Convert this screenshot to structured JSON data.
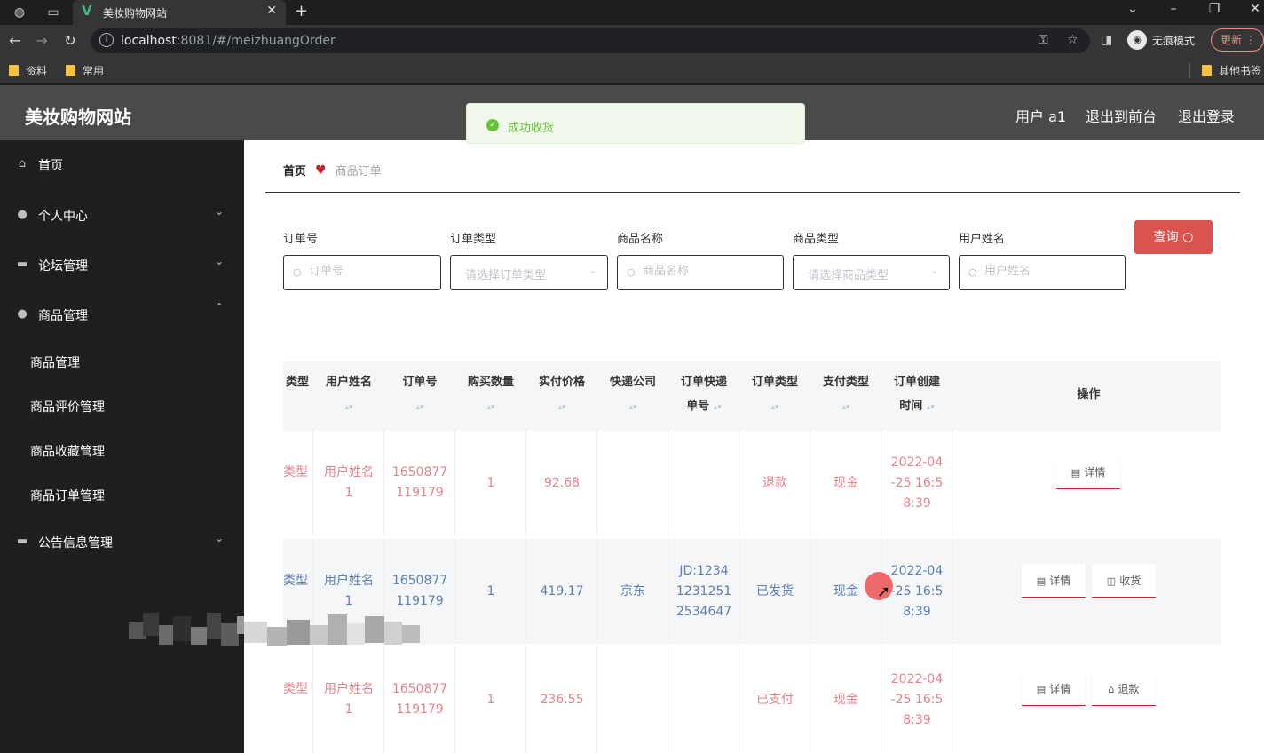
{
  "browser": {
    "tab_title": "美妆购物网站",
    "url_host": "localhost",
    "url_rest": ":8081/#/meizhuangOrder",
    "incognito_label": "无痕模式",
    "update_label": "更新",
    "bookmarks": [
      "资料",
      "常用"
    ],
    "other_bookmarks": "其他书签"
  },
  "header": {
    "site_title": "美妆购物网站",
    "user": "用户 a1",
    "front_link": "退出到前台",
    "logout_link": "退出登录"
  },
  "toast": {
    "text": "成功收货"
  },
  "sidebar": {
    "home": "首页",
    "personal": "个人中心",
    "forum": "论坛管理",
    "goods": "商品管理",
    "sub": [
      "商品管理",
      "商品评价管理",
      "商品收藏管理",
      "商品订单管理"
    ],
    "notice": "公告信息管理"
  },
  "breadcrumb": {
    "home": "首页",
    "current": "商品订单"
  },
  "filters": {
    "order_no": {
      "label": "订单号",
      "placeholder": "订单号"
    },
    "order_type": {
      "label": "订单类型",
      "placeholder": "请选择订单类型"
    },
    "goods_name": {
      "label": "商品名称",
      "placeholder": "商品名称"
    },
    "goods_type": {
      "label": "商品类型",
      "placeholder": "请选择商品类型"
    },
    "user_name": {
      "label": "用户姓名",
      "placeholder": "用户姓名"
    },
    "query_button": "查询"
  },
  "table": {
    "headers": {
      "type_partial": "类型",
      "user": "用户姓名",
      "order_no": "订单号",
      "qty": "购买数量",
      "price": "实付价格",
      "courier": "快递公司",
      "tracking_1": "订单快递",
      "tracking_2": "单号",
      "order_type": "订单类型",
      "pay_type": "支付类型",
      "created_1": "订单创建",
      "created_2": "时间",
      "ops": "操作"
    },
    "rows": [
      {
        "type_partial": "类型",
        "user_1": "用户姓名",
        "user_2": "1",
        "order_1": "1650877",
        "order_2": "119179",
        "qty": "1",
        "price": "92.68",
        "courier": "",
        "track_1": "",
        "track_2": "",
        "track_3": "",
        "order_type": "退款",
        "pay_type": "现金",
        "time_1": "2022-04",
        "time_2": "-25 16:5",
        "time_3": "8:39",
        "btn1": "详情"
      },
      {
        "type_partial": "类型",
        "user_1": "用户姓名",
        "user_2": "1",
        "order_1": "1650877",
        "order_2": "119179",
        "qty": "1",
        "price": "419.17",
        "courier": "京东",
        "track_1": "JD:1234",
        "track_2": "1231251",
        "track_3": "2534647",
        "order_type": "已发货",
        "pay_type": "现金",
        "time_1": "2022-04",
        "time_2": "-25 16:5",
        "time_3": "8:39",
        "btn1": "详情",
        "btn2": "收货"
      },
      {
        "type_partial": "类型",
        "user_1": "用户姓名",
        "user_2": "1",
        "order_1": "1650877",
        "order_2": "119179",
        "qty": "1",
        "price": "236.55",
        "courier": "",
        "track_1": "",
        "track_2": "",
        "track_3": "",
        "order_type": "已支付",
        "pay_type": "现金",
        "time_1": "2022-04",
        "time_2": "-25 16:5",
        "time_3": "8:39",
        "btn1": "详情",
        "btn2": "退款"
      }
    ]
  },
  "colors": {
    "accent_red": "#d9534f",
    "row_red": "#e8828a",
    "row_blue": "#5b7fb5",
    "header_bg": "#4a4a4a",
    "sidebar_bg": "#1f1f1f",
    "toast_green": "#67c23a"
  },
  "icons": [
    "globe-icon",
    "vue-logo-icon",
    "lock-info-icon",
    "key-icon",
    "star-icon",
    "home-icon",
    "user-icon",
    "forum-icon",
    "goods-icon",
    "notice-icon",
    "search-icon",
    "success-check-icon",
    "document-icon",
    "receive-icon",
    "refund-icon"
  ]
}
